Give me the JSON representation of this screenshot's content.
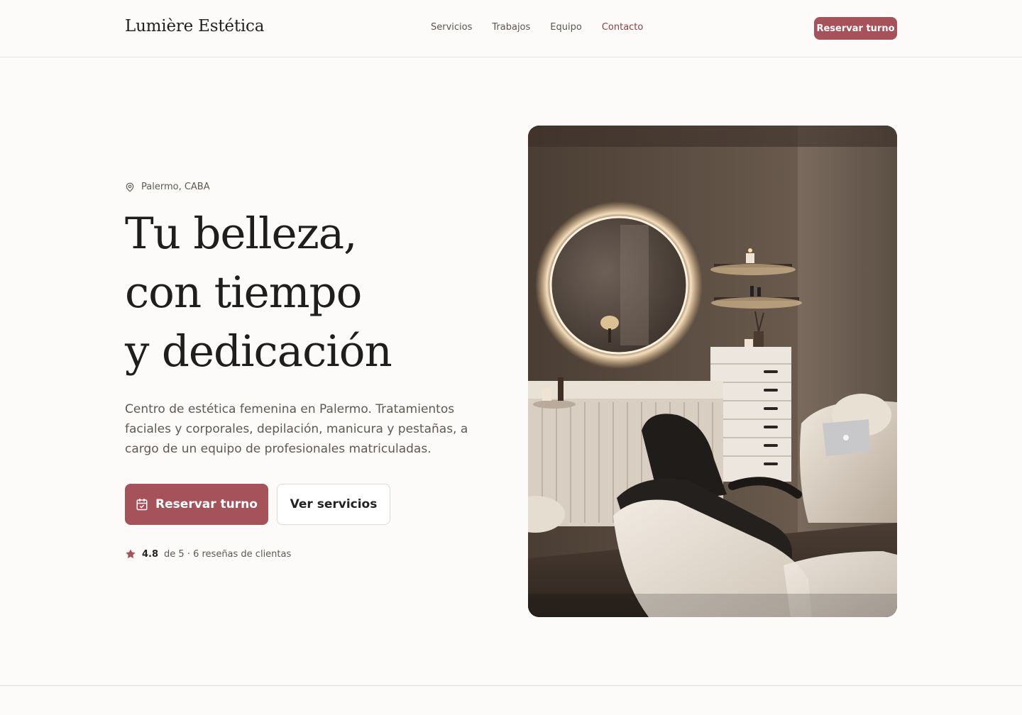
{
  "header": {
    "brand": "Lumière Estética",
    "nav": [
      {
        "label": "Servicios"
      },
      {
        "label": "Trabajos"
      },
      {
        "label": "Equipo"
      },
      {
        "label": "Contacto"
      }
    ],
    "cta": "Reservar turno"
  },
  "hero": {
    "location": "Palermo, CABA",
    "headline": [
      "Tu belleza,",
      "con tiempo",
      "y dedicación"
    ],
    "description": "Centro de estética femenina en Palermo. Tratamientos faciales y corporales, depilación, manicura y pestañas, a cargo de un equipo de profesionales matriculadas.",
    "primary_cta": "Reservar turno",
    "secondary_cta": "Ver servicios",
    "rating": {
      "score": "4.8",
      "text": "de 5 · 6 reseñas de clientas"
    }
  },
  "colors": {
    "accent": "#a5525a",
    "background": "#fcfbf9",
    "text": "#1e1e1e"
  },
  "icons": {
    "location": "map-pin-icon",
    "calendar": "calendar-check-icon",
    "star": "star-icon"
  }
}
